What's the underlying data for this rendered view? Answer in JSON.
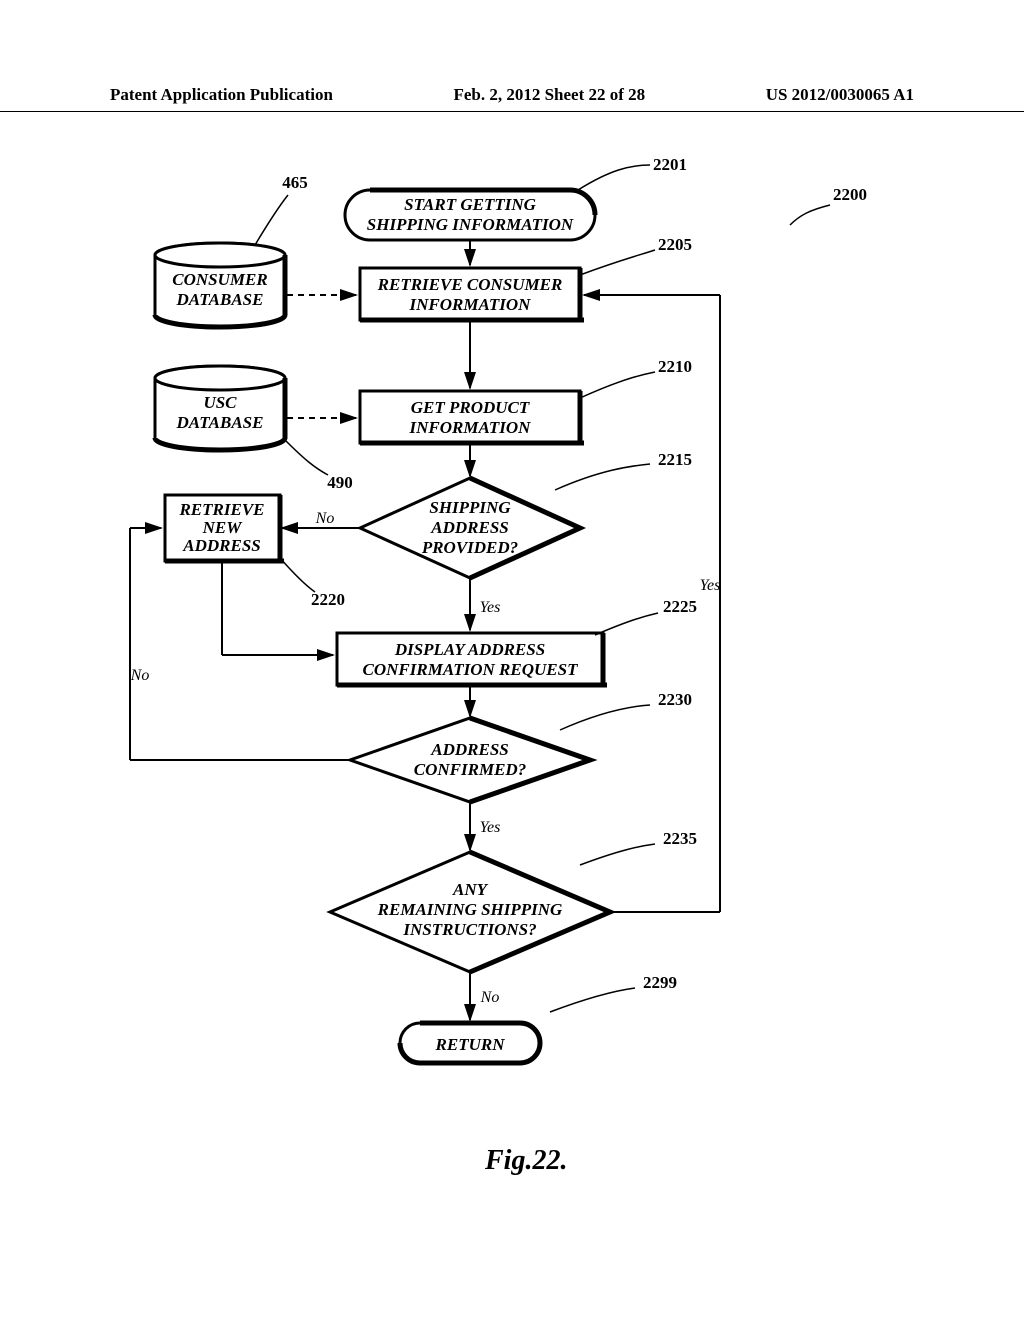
{
  "header": {
    "left": "Patent Application Publication",
    "center": "Feb. 2, 2012  Sheet 22 of 28",
    "right": "US 2012/0030065 A1"
  },
  "refs": {
    "r465": "465",
    "r490": "490",
    "r2200": "2200",
    "r2201": "2201",
    "r2205": "2205",
    "r2210": "2210",
    "r2215": "2215",
    "r2220": "2220",
    "r2225": "2225",
    "r2230": "2230",
    "r2235": "2235",
    "r2299": "2299"
  },
  "nodes": {
    "start1": "START GETTING",
    "start2": "SHIPPING INFORMATION",
    "consumerdb1": "CONSUMER",
    "consumerdb2": "DATABASE",
    "uscdb1": "USC",
    "uscdb2": "DATABASE",
    "retrieve1": "RETRIEVE CONSUMER",
    "retrieve2": "INFORMATION",
    "product1": "GET PRODUCT",
    "product2": "INFORMATION",
    "shipaddr1": "SHIPPING",
    "shipaddr2": "ADDRESS",
    "shipaddr3": "PROVIDED?",
    "newaddr1": "RETRIEVE",
    "newaddr2": "NEW",
    "newaddr3": "ADDRESS",
    "display1": "DISPLAY ADDRESS",
    "display2": "CONFIRMATION REQUEST",
    "confirmed1": "ADDRESS",
    "confirmed2": "CONFIRMED?",
    "remaining1": "ANY",
    "remaining2": "REMAINING SHIPPING",
    "remaining3": "INSTRUCTIONS?",
    "return": "RETURN"
  },
  "edges": {
    "yes": "Yes",
    "no": "No"
  },
  "caption": "Fig.22."
}
